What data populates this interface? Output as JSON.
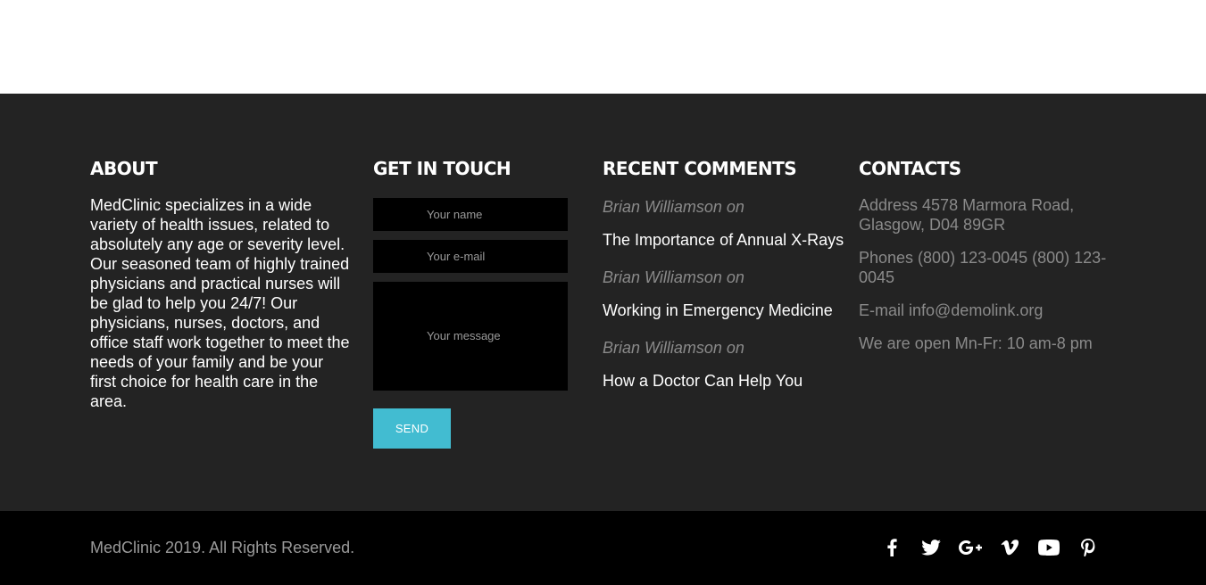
{
  "about": {
    "heading": "ABOUT",
    "text": "MedClinic specializes in a wide variety of health issues, related to absolutely any age or severity level. Our seasoned team of highly trained physicians and practical nurses will be glad to help you 24/7! Our physicians, nurses, doctors, and office staff work together to meet the needs of your family and be your first choice for health care in the area."
  },
  "contact_form": {
    "heading": "GET IN TOUCH",
    "name_placeholder": "Your name",
    "email_placeholder": "Your e-mail",
    "message_placeholder": "Your message",
    "send_label": "SEND"
  },
  "recent_comments": {
    "heading": "RECENT COMMENTS",
    "items": [
      {
        "author": "Brian Williamson on",
        "post": "The Importance of Annual X-Rays"
      },
      {
        "author": "Brian Williamson on",
        "post": "Working in Emergency Medicine"
      },
      {
        "author": "Brian Williamson on",
        "post": "How a Doctor Can Help You"
      }
    ]
  },
  "contacts": {
    "heading": "CONTACTS",
    "address": "Address 4578 Marmora Road, Glasgow, D04 89GR",
    "phones": "Phones (800) 123-0045 (800) 123-0045",
    "email": "E-mail info@demolink.org",
    "hours": "We are open Mn-Fr: 10 am-8 pm"
  },
  "bottom_bar": {
    "copyright": "MedClinic 2019. All Rights Reserved.",
    "social_icons": [
      "facebook-icon",
      "twitter-icon",
      "google-plus-icon",
      "vimeo-icon",
      "youtube-icon",
      "pinterest-icon"
    ]
  },
  "colors": {
    "footer_bg": "#232323",
    "bottom_bg": "#000000",
    "accent": "#42bcd1",
    "muted_text": "#8a8a8a"
  }
}
